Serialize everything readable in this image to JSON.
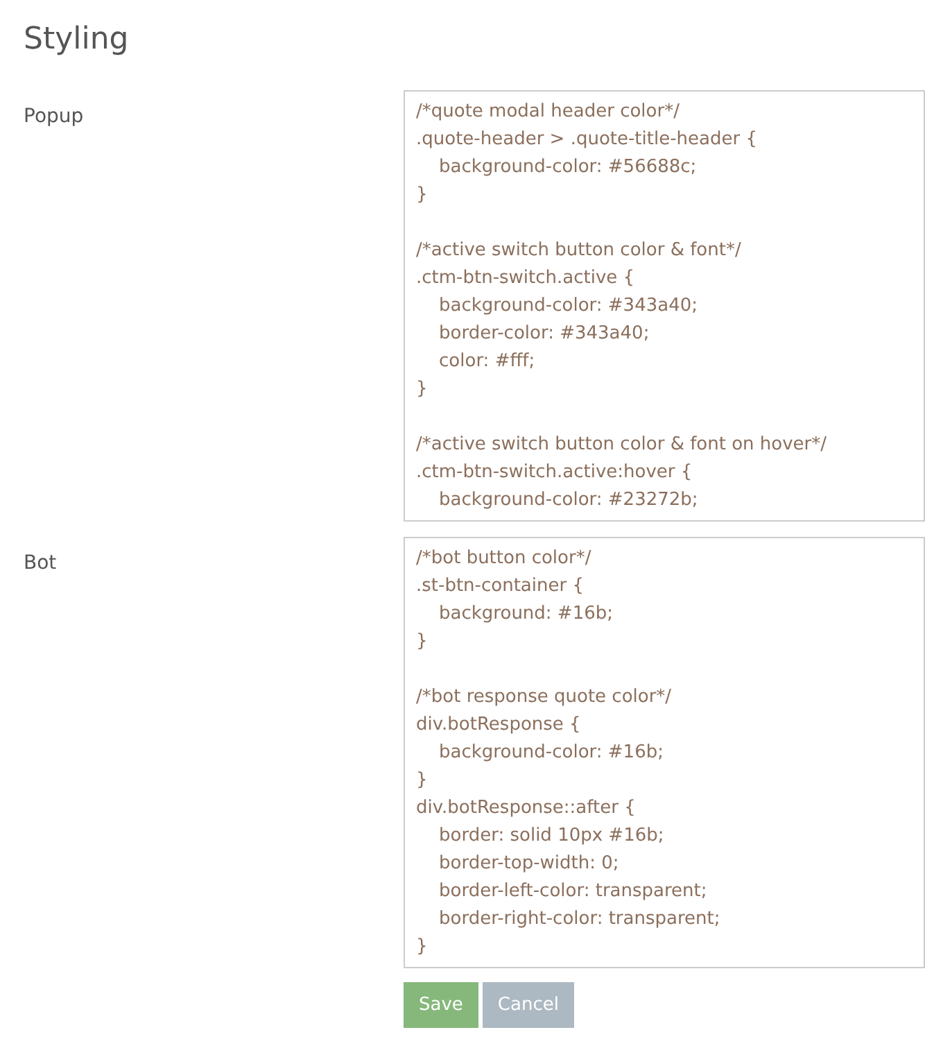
{
  "title": "Styling",
  "fields": [
    {
      "label": "Popup",
      "blocks": [
        [
          "/*quote modal header color*/",
          ".quote-header > .quote-title-header {",
          "    background-color: #56688c;",
          "}"
        ],
        [
          "/*active switch button color & font*/",
          ".ctm-btn-switch.active {",
          "    background-color: #343a40;",
          "    border-color: #343a40;",
          "    color: #fff;",
          "}"
        ],
        [
          "/*active switch button color & font on hover*/",
          ".ctm-btn-switch.active:hover {",
          "    background-color: #23272b;"
        ]
      ]
    },
    {
      "label": "Bot",
      "blocks": [
        [
          "/*bot button color*/",
          ".st-btn-container {",
          "    background: #16b;",
          "}"
        ],
        [
          "/*bot response quote color*/",
          "div.botResponse {",
          "    background-color: #16b;",
          "}",
          "div.botResponse::after {",
          "    border: solid 10px #16b;",
          "    border-top-width: 0;",
          "    border-left-color: transparent;",
          "    border-right-color: transparent;",
          "}"
        ]
      ]
    }
  ],
  "buttons": [
    {
      "label": "Save",
      "kind": "primary"
    },
    {
      "label": "Cancel",
      "kind": "secondary"
    }
  ]
}
